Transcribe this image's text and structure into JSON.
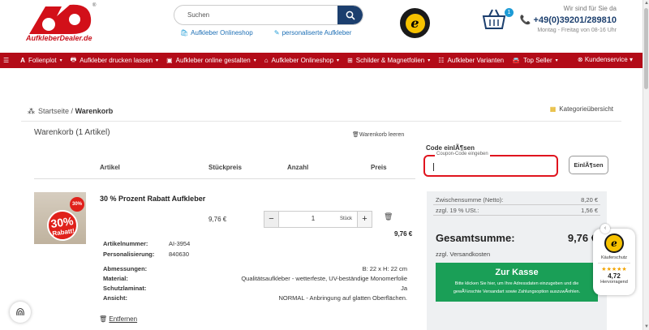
{
  "header": {
    "logo_text": "AufkleberDealer.de",
    "search_placeholder": "Suchen",
    "link_1": "Aufkleber Onlineshop",
    "link_2": "personaliserte Aufkleber",
    "cart_count": "1",
    "contact_line1": "Wir sind für Sie da",
    "contact_phone": "+49(0)39201/289810",
    "contact_hours": "Montag - Freitag von 08-16 Uhr"
  },
  "nav": {
    "items": [
      {
        "label": "Folienplot",
        "icon": "A"
      },
      {
        "label": "Aufkleber drucken lassen",
        "icon": "printer-icon"
      },
      {
        "label": "Aufkleber online gestalten",
        "icon": "image-icon"
      },
      {
        "label": "Aufkleber Onlineshop",
        "icon": "shop-icon"
      },
      {
        "label": "Schilder & Magnetfolien",
        "icon": "sign-icon"
      },
      {
        "label": "Aufkleber Varianten",
        "icon": "list-icon"
      },
      {
        "label": "Top Seller",
        "icon": "car-icon"
      }
    ],
    "service": "Kundenservice"
  },
  "breadcrumb": {
    "home": "Startseite",
    "sep": "/",
    "current": "Warenkorb",
    "categories": "Kategorieübersicht"
  },
  "cart": {
    "title": "Warenkorb (1 Artikel)",
    "clear": "Warenkorb leeren",
    "headers": {
      "article": "Artikel",
      "unit_price": "Stückpreis",
      "quantity": "Anzahl",
      "price": "Preis"
    },
    "item": {
      "name": "30 % Prozent Rabatt Aufkleber",
      "unit_price": "9,76 €",
      "quantity": "1",
      "quantity_unit": "Stück",
      "total": "9,76 €",
      "badge_big": "30%",
      "badge_small": "Rabatt!",
      "badge_corner": "30%",
      "article_no_label": "Artikelnummer:",
      "article_no": "AI-3954",
      "personal_label": "Personalisierung:",
      "personal": "840630",
      "dim_label": "Abmessungen:",
      "dim": "B: 22 x H: 22 cm",
      "material_label": "Material:",
      "material": "Qualitätsaufkleber - wetterfeste, UV-beständige Monomerfolie",
      "laminate_label": "Schutzlaminat:",
      "laminate": "Ja",
      "view_label": "Ansicht:",
      "view": "NORMAL - Anbringung auf glatten Oberflächen.",
      "remove": "Entfernen"
    }
  },
  "coupon": {
    "title": "Code einlÃ¶sen",
    "label": "Coupon-Code eingeben",
    "button": "EinlÃ¶sen"
  },
  "summary": {
    "subtotal_label": "Zwischensumme (Netto):",
    "subtotal": "8,20 €",
    "vat_label": "zzgl. 19 % USt.:",
    "vat": "1,56 €",
    "total_label": "Gesamtsumme:",
    "total": "9,76 €",
    "shipping": "zzgl. Versandkosten",
    "checkout": "Zur Kasse",
    "checkout_sub": "Bitte klicken Sie hier, um Ihre Adressdaten einzugeben und die gewÃ¼nschte Versandart sowie Zahlungsoption auszuwÃ¤hlen."
  },
  "trusted_widget": {
    "label": "Käuferschutz",
    "stars": "★★★★★",
    "score": "4,72",
    "rating": "Hervorragend"
  },
  "colors": {
    "brand_red": "#b30b18",
    "navy": "#1c3f6e",
    "green": "#1a9f57",
    "link_blue": "#1d6fb5"
  }
}
